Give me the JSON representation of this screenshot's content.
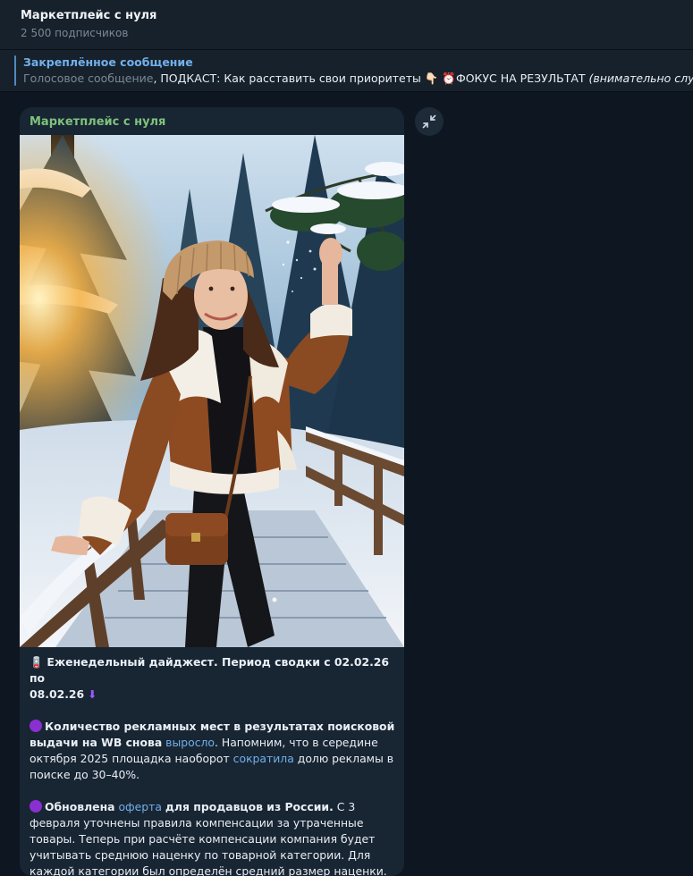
{
  "channel": {
    "title": "Маркетплейс с нуля",
    "subscribers": "2 500 подписчиков"
  },
  "pinned": {
    "label": "Закреплённое сообщение",
    "prefix": "Голосовое сообщение",
    "separator": ", ",
    "text_main": "ПОДКАСТ: Как расставить свои приоритеты 👇🏻 ⏰ФОКУС НА РЕЗУЛЬТАТ ",
    "text_italic": "(внимательно слушаем,"
  },
  "post": {
    "author": "Маркетплейс с нуля",
    "photo_alt": "Женщина в коричневой дублёнке на заснеженном мосту в зимнем лесу",
    "digest_icon": "🪫",
    "digest_line1": "Еженедельный дайджест. Период сводки с 02.02.26 по",
    "digest_line2": "08.02.26",
    "digest_arrow": "⬇",
    "item1": {
      "bold_a": "Количество рекламных мест в результатах поисковой выдачи на WB снова",
      "link_a": "выросло",
      "text_a": ". Напомним, что в середине октября 2025 площадка наоборот",
      "link_b": "сократила",
      "text_b": "долю рекламы в поиске до 30–40%."
    },
    "item2": {
      "bold_a": "Обновлена",
      "link_a": "оферта",
      "bold_b": "для продавцов из России.",
      "text_a": "С 3 февраля уточнены правила компенсации за утраченные товары. Теперь при расчёте компенсации компания будет учитывать среднюю наценку по товарной категории. Для каждой категории был определён средний размер наценки. Соответствующий список с"
    }
  },
  "controls": {
    "collapse_icon": "collapse-arrows-icon"
  },
  "colors": {
    "background": "#0e1621",
    "header": "#17212b",
    "bubble": "#182533",
    "link": "#71b0ec",
    "author": "#7ec27c",
    "purple_dot": "#8a2fd0"
  }
}
